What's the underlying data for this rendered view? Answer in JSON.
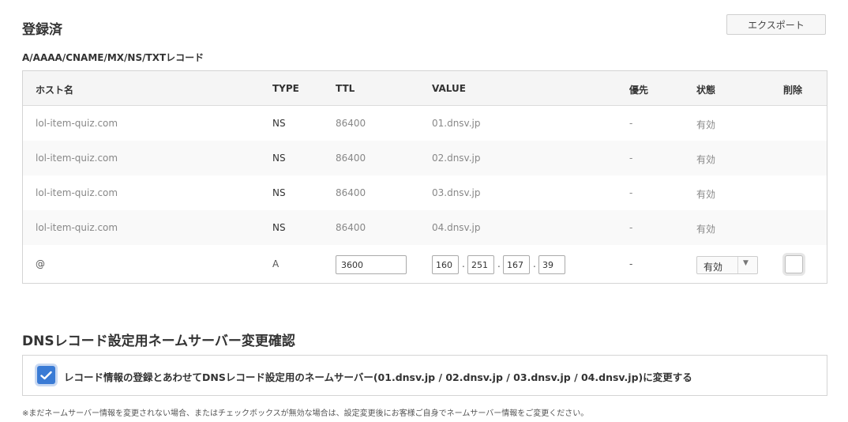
{
  "section": {
    "title": "登録済",
    "export_label": "エクスポート"
  },
  "records": {
    "subtitle": "A/AAAA/CNAME/MX/NS/TXTレコード",
    "headers": {
      "host": "ホスト名",
      "type": "TYPE",
      "ttl": "TTL",
      "value": "VALUE",
      "priority": "優先",
      "status": "状態",
      "delete": "削除"
    },
    "rows": [
      {
        "host": "lol-item-quiz.com",
        "type": "NS",
        "ttl": "86400",
        "value": "01.dnsv.jp",
        "priority": "-",
        "status": "有効"
      },
      {
        "host": "lol-item-quiz.com",
        "type": "NS",
        "ttl": "86400",
        "value": "02.dnsv.jp",
        "priority": "-",
        "status": "有効"
      },
      {
        "host": "lol-item-quiz.com",
        "type": "NS",
        "ttl": "86400",
        "value": "03.dnsv.jp",
        "priority": "-",
        "status": "有効"
      },
      {
        "host": "lol-item-quiz.com",
        "type": "NS",
        "ttl": "86400",
        "value": "04.dnsv.jp",
        "priority": "-",
        "status": "有効"
      }
    ],
    "edit_row": {
      "host": "@",
      "type": "A",
      "ttl": "3600",
      "ip": [
        "160",
        "251",
        "167",
        "39"
      ],
      "ip_sep": ".",
      "priority": "-",
      "status": "有効",
      "delete_checked": false
    }
  },
  "nameserver_confirm": {
    "title": "DNSレコード設定用ネームサーバー変更確認",
    "label": "レコード情報の登録とあわせてDNSレコード設定用のネームサーバー(01.dnsv.jp / 02.dnsv.jp / 03.dnsv.jp / 04.dnsv.jp)に変更する",
    "checked": true,
    "note": "※まだネームサーバー情報を変更されない場合、またはチェックボックスが無効な場合は、設定変更後にお客様ご自身でネームサーバー情報をご変更ください。"
  },
  "colors": {
    "accent": "#3a7bd5",
    "border": "#d4d4d4",
    "header_bg": "#f5f5f5"
  }
}
